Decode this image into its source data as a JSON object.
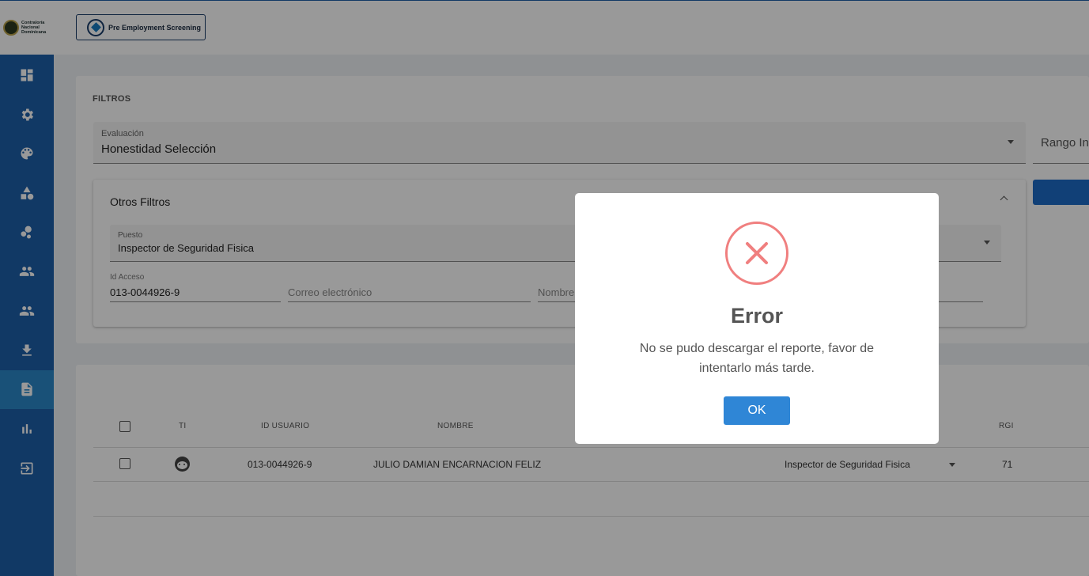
{
  "app": {
    "logo_text": "Contraloría Nacional Dominicana",
    "module_button": "Pre Employment Screening"
  },
  "sidebar": {
    "items": [
      {
        "icon": "dashboard-icon",
        "active": false
      },
      {
        "icon": "gear-icon",
        "active": false
      },
      {
        "icon": "palette-icon",
        "active": false
      },
      {
        "icon": "shapes-icon",
        "active": false
      },
      {
        "icon": "bubbles-icon",
        "active": false
      },
      {
        "icon": "people-icon",
        "active": false
      },
      {
        "icon": "people-icon",
        "active": false
      },
      {
        "icon": "download-icon",
        "active": false
      },
      {
        "icon": "document-icon",
        "active": true
      },
      {
        "icon": "bar-chart-icon",
        "active": false
      },
      {
        "icon": "logout-icon",
        "active": false
      }
    ]
  },
  "filters": {
    "title": "FILTROS",
    "evaluacion_label": "Evaluación",
    "evaluacion_value": "Honestidad Selección",
    "rango_placeholder": "Rango In",
    "otros_title": "Otros Filtros",
    "puesto_label": "Puesto",
    "puesto_value": "Inspector de Seguridad Fisica",
    "id_acceso_label": "Id Acceso",
    "id_acceso_value": "013-0044926-9",
    "correo_placeholder": "Correo electrónico",
    "nombre_placeholder": "Nombre"
  },
  "table": {
    "columns": [
      "TI",
      "ID USUARIO",
      "NOMBRE",
      "RGI"
    ],
    "rows": [
      {
        "id_usuario": "013-0044926-9",
        "nombre": "JULIO DAMIAN ENCARNACION FELIZ",
        "puesto": "Inspector de Seguridad Fisica",
        "rgi": "71"
      }
    ]
  },
  "dialog": {
    "title": "Error",
    "message": "No se pudo descargar el reporte, favor de intentarlo más tarde.",
    "ok_label": "OK",
    "icon": "error-x-icon",
    "accent_color": "#f07f7f",
    "button_color": "#2f86d6"
  }
}
